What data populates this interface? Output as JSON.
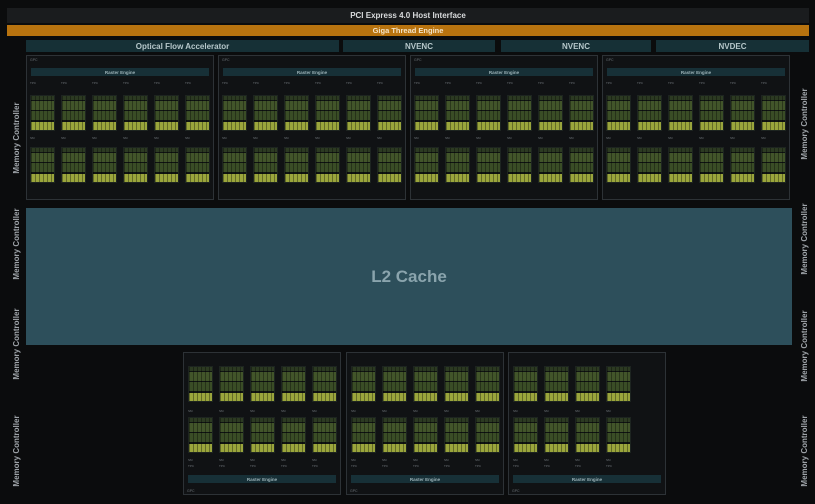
{
  "header": {
    "pcie": "PCI Express 4.0 Host Interface",
    "giga": "Giga Thread Engine"
  },
  "engines": {
    "ofa": "Optical Flow Accelerator",
    "nvenc1": "NVENC",
    "nvenc2": "NVENC",
    "nvdec": "NVDEC"
  },
  "memory_controller": "Memory Controller",
  "l2": "L2 Cache",
  "gpc": {
    "label": "GPC",
    "raster": "Raster Engine",
    "tpc": "TPC",
    "sm": "SM"
  },
  "colors": {
    "giga": "#b8730f",
    "l2": "#2d4f5b",
    "engine": "#163036"
  }
}
